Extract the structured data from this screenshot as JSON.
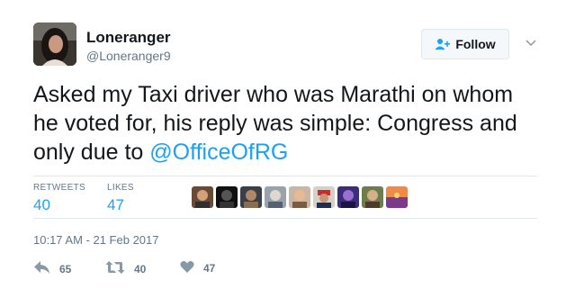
{
  "user": {
    "name": "Loneranger",
    "handle": "@Loneranger9"
  },
  "follow_label": "Follow",
  "tweet": {
    "text_before": "Asked my Taxi driver who was Marathi on whom he voted for, his reply was simple: Congress and only due to ",
    "mention": "@OfficeOfRG"
  },
  "stats": {
    "retweets_label": "RETWEETS",
    "retweets_value": "40",
    "likes_label": "LIKES",
    "likes_value": "47"
  },
  "timestamp": "10:17 AM - 21 Feb 2017",
  "actions": {
    "reply_count": "65",
    "retweet_count": "40",
    "like_count": "47"
  },
  "colors": {
    "accent": "#1da1f2",
    "secondary_text": "#657786",
    "divider": "#e1e8ed"
  },
  "icons": [
    "follow-user-icon",
    "chevron-down-icon",
    "reply-icon",
    "retweet-icon",
    "heart-icon"
  ]
}
